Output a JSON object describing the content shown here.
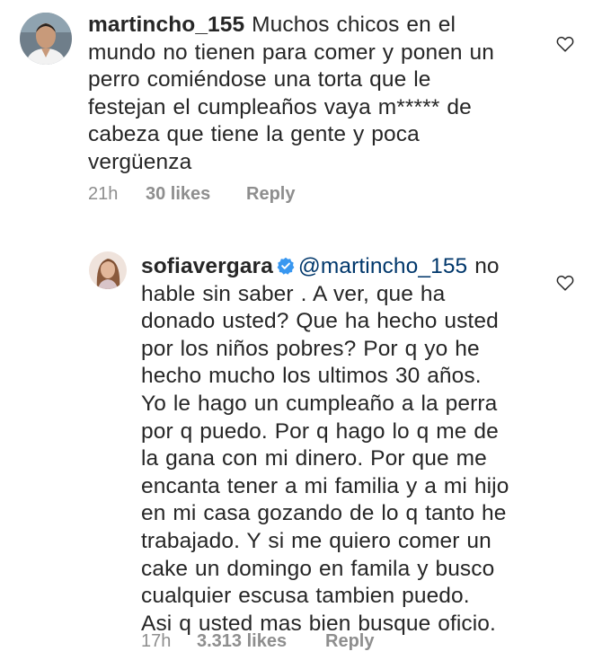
{
  "comments": [
    {
      "username": "martincho_155",
      "verified": false,
      "mention": "",
      "lines": [
        "Muchos chicos en el",
        "mundo no tienen para comer y ponen un",
        "perro comiéndose una torta que le",
        "festejan el cumpleaños vaya m***** de",
        "cabeza que tiene la gente y poca",
        "vergüenza"
      ],
      "time": "21h",
      "likes": "30 likes",
      "reply": "Reply",
      "icons": {
        "like": "heart-outline-icon",
        "avatar": "avatar-man-icon"
      }
    },
    {
      "username": "sofiavergara",
      "verified": true,
      "mention": "@martincho_155",
      "lines": [
        "no",
        "hable sin saber . A ver, que ha",
        "donado usted? Que ha hecho usted",
        "por los niños pobres? Por q yo he",
        "hecho mucho los ultimos 30 años.",
        "Yo le hago un cumpleaño a la perra",
        "por q puedo. Por q hago lo q me de",
        "la gana con mi dinero. Por que me",
        "encanta tener a mi familia y a mi hijo",
        "en mi casa gozando de lo q tanto he",
        "trabajado. Y si me quiero comer un",
        "cake un domingo en famila y busco",
        "cualquier escusa tambien puedo.",
        "Asi q usted mas bien busque oficio."
      ],
      "time": "17h",
      "likes": "3.313 likes",
      "reply": "Reply",
      "icons": {
        "like": "heart-outline-icon",
        "avatar": "avatar-woman-icon",
        "verified": "verified-badge-icon"
      }
    }
  ],
  "colors": {
    "text": "#262626",
    "meta": "#8e8e8e",
    "mention": "#00376b",
    "verified": "#3897f0"
  }
}
